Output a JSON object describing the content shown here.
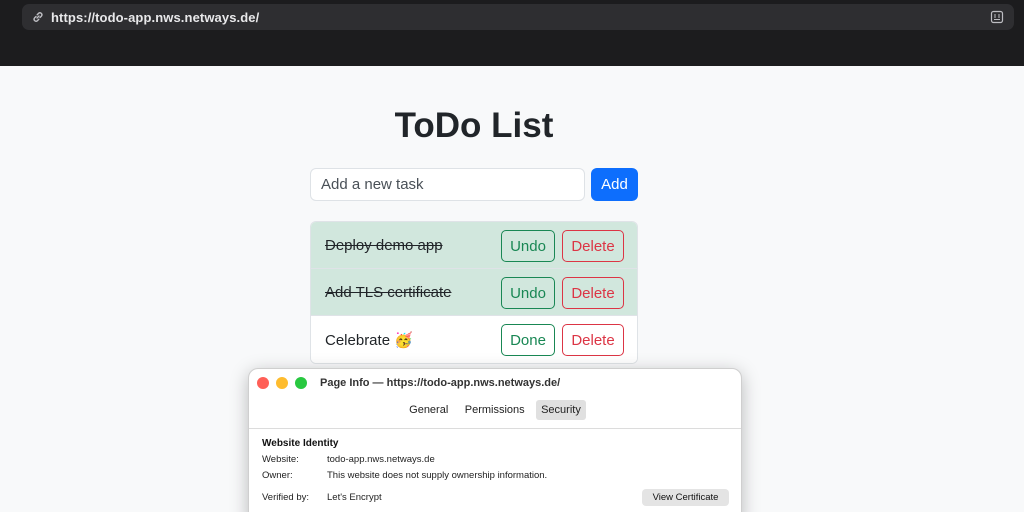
{
  "browser": {
    "url": "https://todo-app.nws.netways.de/"
  },
  "app": {
    "title": "ToDo List",
    "input_placeholder": "Add a new task",
    "add_label": "Add",
    "tasks": [
      {
        "text": "Deploy demo app",
        "completed": true,
        "toggle_label": "Undo",
        "delete_label": "Delete"
      },
      {
        "text": "Add TLS certificate",
        "completed": true,
        "toggle_label": "Undo",
        "delete_label": "Delete"
      },
      {
        "text": "Celebrate 🥳",
        "completed": false,
        "toggle_label": "Done",
        "delete_label": "Delete"
      }
    ]
  },
  "page_info": {
    "title": "Page Info — https://todo-app.nws.netways.de/",
    "tabs": [
      "General",
      "Permissions",
      "Security"
    ],
    "active_tab": "Security",
    "section_title": "Website Identity",
    "website_label": "Website:",
    "website_value": "todo-app.nws.netways.de",
    "owner_label": "Owner:",
    "owner_value": "This website does not supply ownership information.",
    "verified_label": "Verified by:",
    "verified_value": "Let's Encrypt",
    "view_cert_label": "View Certificate"
  },
  "colors": {
    "primary": "#0d6efd",
    "success": "#198754",
    "danger": "#dc3545",
    "done_row": "#d1e7dd"
  }
}
